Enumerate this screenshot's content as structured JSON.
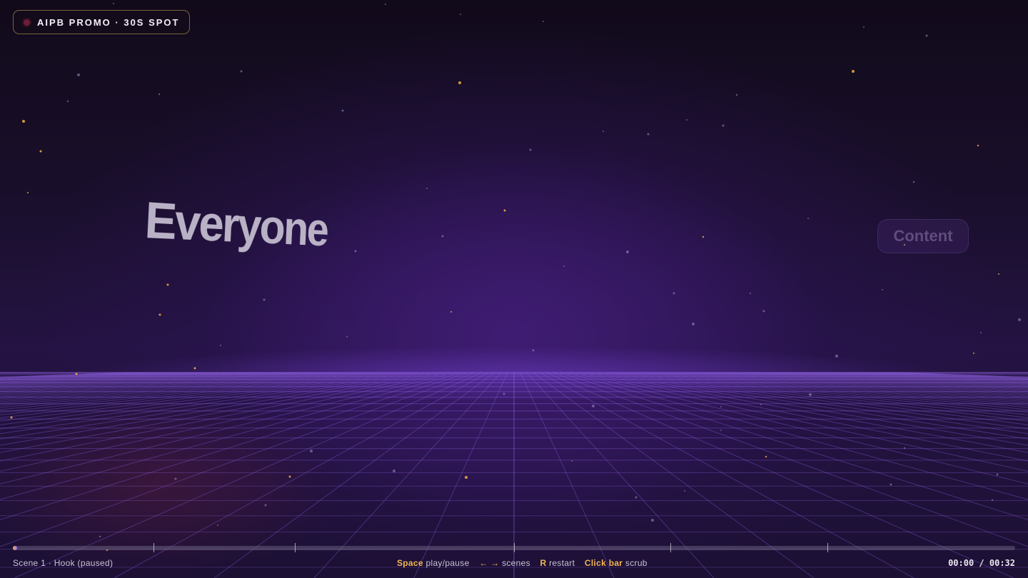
{
  "badge": {
    "label": "AIPB PROMO · 30S SPOT"
  },
  "scene_words": {
    "primary": "Everyone",
    "secondary": "Content"
  },
  "player": {
    "scene_label": "Scene 1 · Hook (paused)",
    "time": "00:00 / 00:32",
    "progress": 0.0,
    "duration_seconds": 32
  },
  "controls": [
    {
      "key": "Space",
      "action": "play/pause"
    },
    {
      "key": "← →",
      "action": "scenes"
    },
    {
      "key": "R",
      "action": "restart"
    },
    {
      "key": "Click bar",
      "action": "scrub"
    }
  ],
  "colors": {
    "accent": "#f0b650",
    "progress_end": "#9b6bff",
    "badge_dot": "#6b1e34"
  }
}
